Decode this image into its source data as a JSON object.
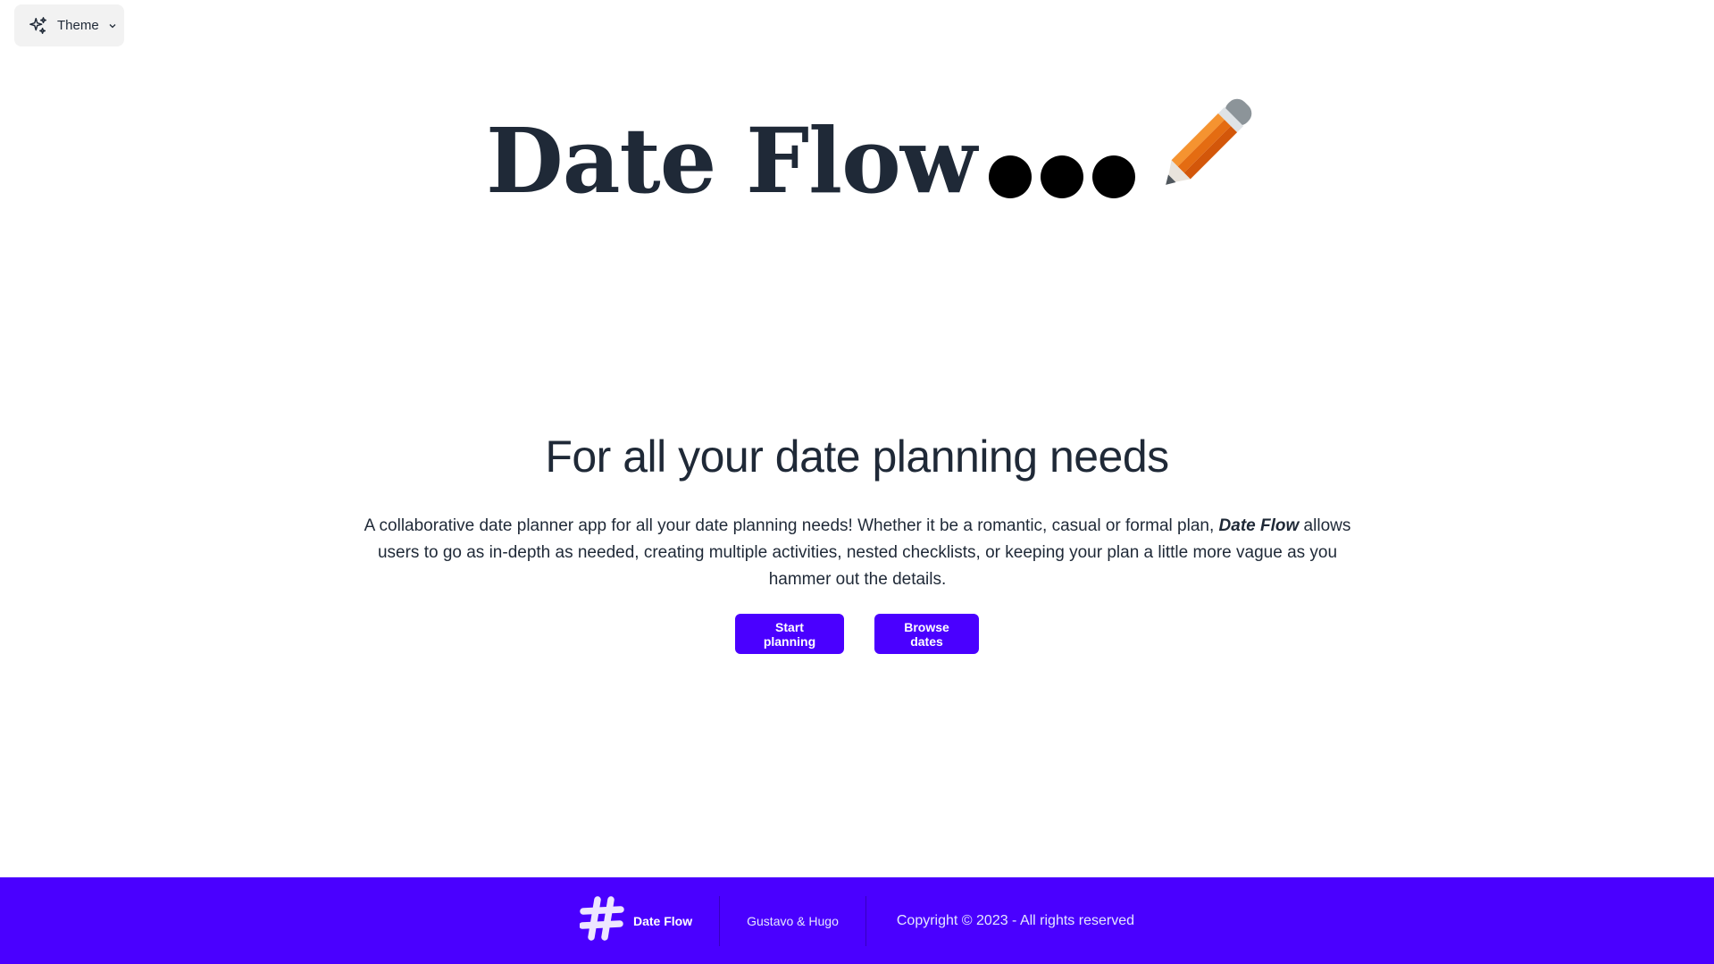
{
  "theme_button": {
    "label": "Theme",
    "icon": "sparkles-icon",
    "chevron": "chevron-down-icon"
  },
  "hero": {
    "title": "Date Flow",
    "decoration_icons": [
      "typing-dots-icon",
      "pencil-icon"
    ]
  },
  "main": {
    "heading": "For all your date planning needs",
    "description_part1": "A collaborative date planner app for all your date planning needs! Whether it be a romantic, casual or formal plan, ",
    "description_brand": "Date Flow",
    "description_part2": " allows users to go as in-depth as needed, creating multiple activities, nested checklists, or keeping your plan a little more vague as you hammer out the details.",
    "buttons": {
      "start": "Start planning",
      "browse": "Browse dates"
    }
  },
  "footer": {
    "logo_icon": "hashtag-icon",
    "brand": "Date Flow",
    "authors": "Gustavo & Hugo",
    "copyright": "Copyright © 2023 - All rights reserved"
  },
  "colors": {
    "primary": "#4a00ff",
    "text": "#1f2937",
    "theme_button_bg": "#f2f2f2"
  }
}
